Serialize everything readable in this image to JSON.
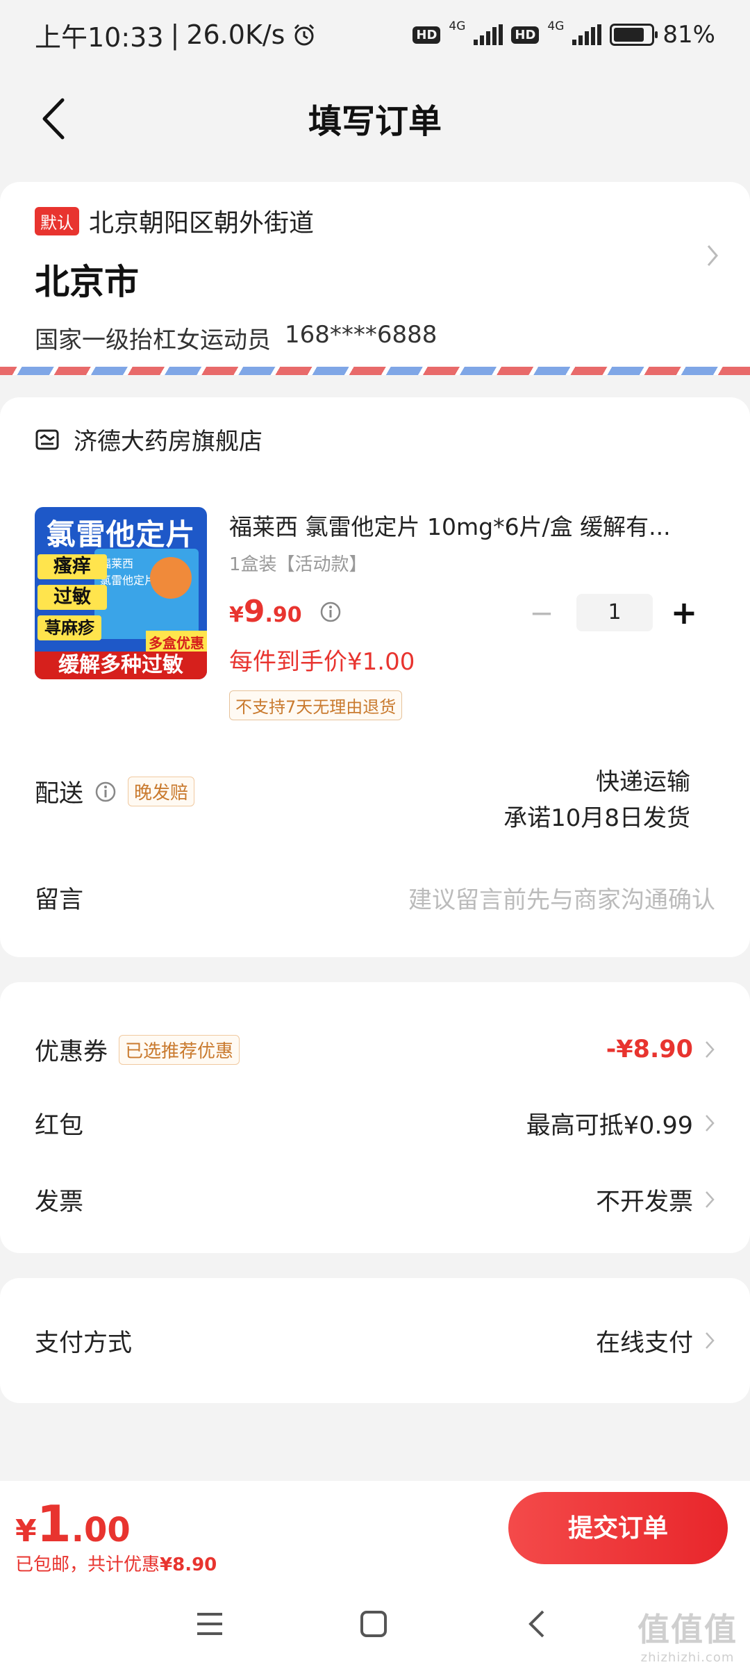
{
  "status_bar": {
    "time": "上午10:33",
    "speed": "26.0K/s",
    "hd": "HD",
    "net1": "4G",
    "net2": "4G",
    "battery": "81%",
    "battery_level": 0.81
  },
  "header": {
    "title": "填写订单"
  },
  "address": {
    "default_tag": "默认",
    "detail": "北京朝阳区朝外街道",
    "city": "北京市",
    "name": "国家一级抬杠女运动员",
    "phone": "168****6888"
  },
  "store": {
    "name": "济德大药房旗舰店"
  },
  "product": {
    "image_text": {
      "title": "氯雷他定片",
      "chip1": "瘙痒",
      "chip2": "过敏",
      "chip3": "荨麻疹",
      "corner": "多盒优惠",
      "bottom": "缓解多种过敏",
      "box_brand": "福莱西",
      "box_name": "氯雷他定片"
    },
    "name": "福莱西 氯雷他定片 10mg*6片/盒 缓解有...",
    "spec": "1盒装【活动款】",
    "price_symbol": "¥",
    "price_int": "9",
    "price_dec": ".90",
    "quantity": "1",
    "unit_price": "每件到手价¥1.00",
    "return_policy": "不支持7天无理由退货"
  },
  "delivery": {
    "label": "配送",
    "tag": "晚发赔",
    "method": "快递运输",
    "promise": "承诺10月8日发货"
  },
  "message": {
    "label": "留言",
    "placeholder": "建议留言前先与商家沟通确认"
  },
  "discounts": {
    "coupon_label": "优惠券",
    "coupon_tag": "已选推荐优惠",
    "coupon_value": "-¥8.90",
    "redpacket_label": "红包",
    "redpacket_value": "最高可抵¥0.99",
    "invoice_label": "发票",
    "invoice_value": "不开发票"
  },
  "payment": {
    "label": "支付方式",
    "value": "在线支付"
  },
  "footer": {
    "total_symbol": "¥",
    "total_int": "1",
    "total_dec": ".00",
    "shipping_note": "已包邮，共计优惠",
    "saved": "¥8.90",
    "submit_label": "提交订单"
  },
  "watermark": {
    "main": "值值值",
    "sub": "zhizhizhi.com"
  },
  "colors": {
    "accent": "#e8342f",
    "tag_orange": "#c97a2e",
    "page_bg": "#f3f3f3"
  }
}
